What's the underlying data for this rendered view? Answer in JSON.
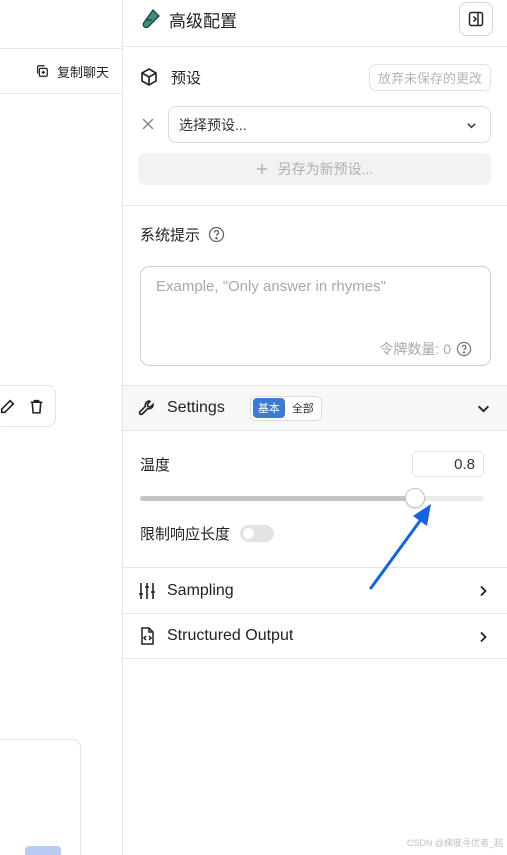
{
  "left": {
    "copy_chat_label": "复制聊天"
  },
  "header": {
    "title": "高级配置"
  },
  "preset": {
    "label": "预设",
    "discard_label": "放弃未保存的更改",
    "select_placeholder": "选择预设...",
    "save_new_label": "另存为新预设..."
  },
  "system_prompt": {
    "title": "系统提示",
    "placeholder": "Example, \"Only answer in rhymes\"",
    "token_label": "令牌数量: 0"
  },
  "settings": {
    "label": "Settings",
    "mode_basic": "基本",
    "mode_all": "全部",
    "temperature_label": "温度",
    "temperature_value": "0.8",
    "temperature_fraction": 0.8,
    "limit_length_label": "限制响应长度",
    "limit_length_enabled": false
  },
  "sections": {
    "sampling": "Sampling",
    "structured_output": "Structured Output"
  },
  "watermark": "CSDN @梯度寻优者_超",
  "colors": {
    "accent": "#3a7bd5",
    "annotation_arrow": "#1463e6",
    "beaker_icon": "#3a8f86"
  }
}
